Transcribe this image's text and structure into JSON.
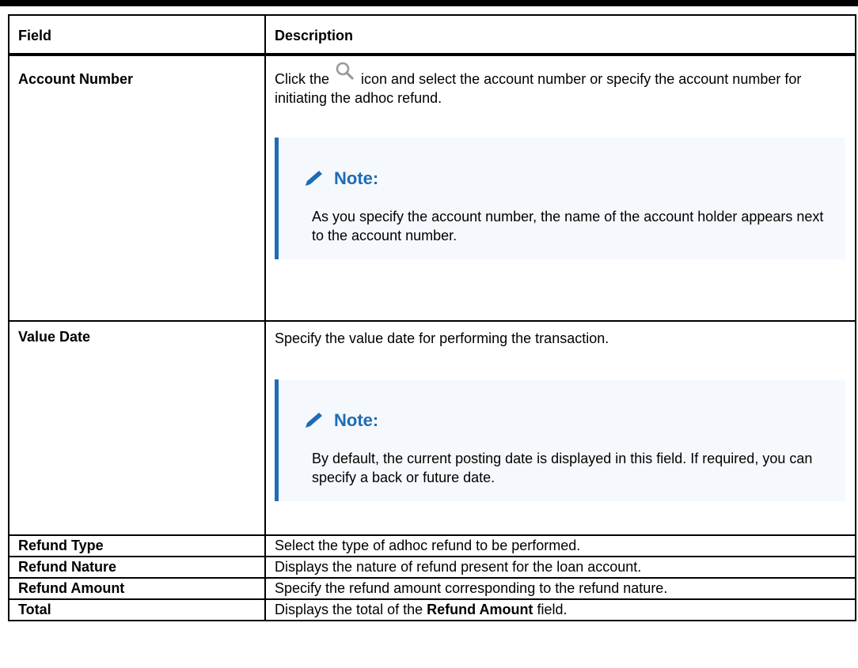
{
  "table": {
    "header": {
      "field": "Field",
      "description": "Description"
    },
    "rows": {
      "account_number": {
        "field": "Account Number",
        "desc_before_icon": "Click the",
        "desc_after_icon": "icon and select the account number or specify the account number for initiating the adhoc refund.",
        "note_title": "Note:",
        "note_text": "As you specify the account number, the name of the account holder appears next to the account number."
      },
      "value_date": {
        "field": "Value Date",
        "desc": "Specify the value date for performing the transaction.",
        "note_title": "Note:",
        "note_text": "By default, the current posting date is displayed in this field. If required, you can specify a back or future date."
      },
      "refund_type": {
        "field": "Refund Type",
        "desc": "Select the type of adhoc refund to be performed."
      },
      "refund_nature": {
        "field": "Refund Nature",
        "desc": "Displays the nature of refund present for the loan account."
      },
      "refund_amount": {
        "field": "Refund Amount",
        "desc": "Specify the refund amount corresponding to the refund nature."
      },
      "total": {
        "field": "Total",
        "desc_prefix": "Displays the total of the",
        "desc_bold": "Refund Amount",
        "desc_suffix": "field."
      }
    }
  },
  "colors": {
    "note_accent": "#1f6bb4",
    "note_background": "#f5f9fd",
    "search_icon": "#9a9a9a"
  },
  "icons": {
    "search": "search-icon",
    "note": "pencil-icon"
  }
}
